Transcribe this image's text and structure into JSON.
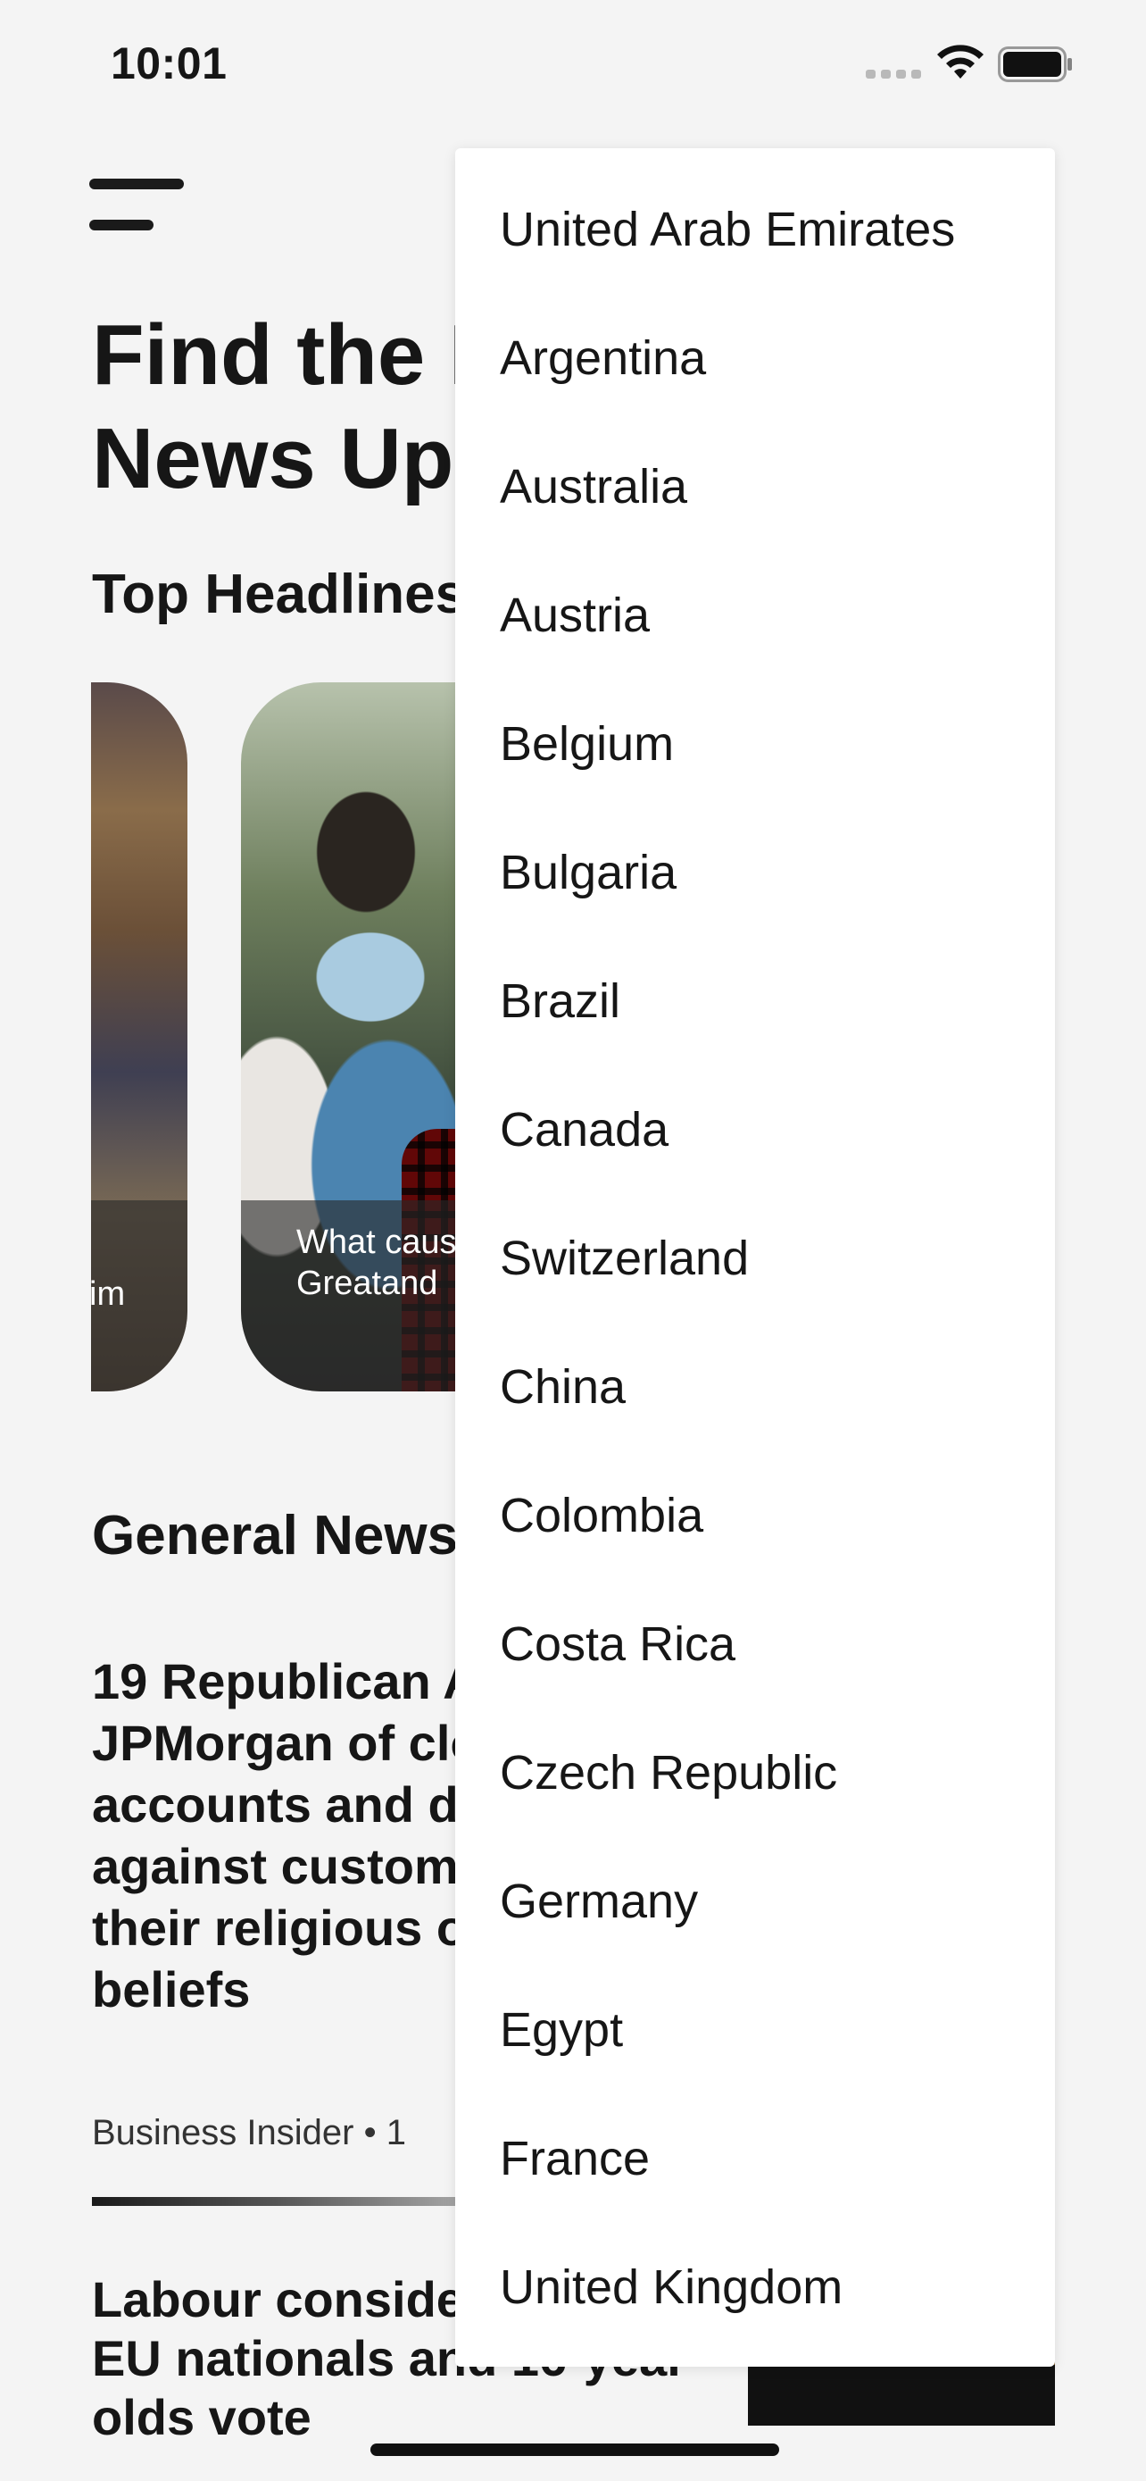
{
  "status_bar": {
    "time": "10:01"
  },
  "header": {
    "title": "Find the Latest\nNews Updates"
  },
  "sections": {
    "top_headlines": "Top Headlines",
    "general_news": "General News"
  },
  "carousel": {
    "left_card_fragment": "im",
    "main_card_caption": "What caused\nGreatand"
  },
  "articles": [
    {
      "title": "19 Republican AGs accuse JPMorgan of closing bank accounts and discriminating against customers due to their religious or political beliefs",
      "meta": "Business Insider • 1"
    },
    {
      "title": "Labour considers plan to let EU nationals and 16-year-olds vote"
    }
  ],
  "country_dropdown": {
    "options": [
      "United Arab Emirates",
      "Argentina",
      "Australia",
      "Austria",
      "Belgium",
      "Bulgaria",
      "Brazil",
      "Canada",
      "Switzerland",
      "China",
      "Colombia",
      "Costa Rica",
      "Czech Republic",
      "Germany",
      "Egypt",
      "France",
      "United Kingdom"
    ]
  }
}
